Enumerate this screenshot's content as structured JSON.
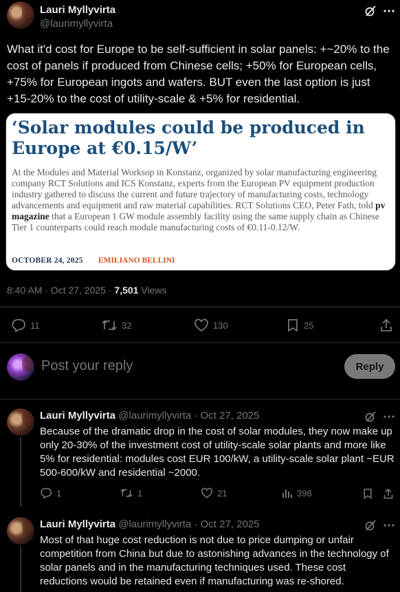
{
  "main_tweet": {
    "author_name": "Lauri Myllyvirta",
    "author_handle": "@laurimyllyvirta",
    "text": "What it'd cost for Europe to be self-sufficient in solar panels: +~20% to the cost of panels if produced from Chinese cells; +50% for European cells, +75% for European ingots and wafers. BUT even the last option is just +15-20% to the cost of utility-scale & +5% for residential.",
    "card": {
      "title": "‘Solar modules could be produced in Europe at €0.15/W’",
      "body_pre": "At the Modules and Material Worksop in Konstanz, organized by solar manufacturing engineering company RCT Solutions and ICS Konstanz, experts from the European PV equipment production industry gathered to discuss the current and future trajectory of manufacturing costs, technology advancements and equipment and raw material capabilities. RCT Solutions CEO, Peter Fath, told ",
      "body_bold": "pv magazine",
      "body_post": " that a European 1 GW module assembly facility using the same supply chain as Chinese Tier 1 counterparts could reach module manufacturing costs of €0.11-0.12/W.",
      "date": "OCTOBER 24, 2025",
      "author": "EMILIANO BELLINI"
    },
    "time": "8:40 AM · Oct 27, 2025 · ",
    "views_count": "7,501",
    "views_label": " Views",
    "actions": {
      "replies": "11",
      "reposts": "32",
      "likes": "130",
      "bookmarks": "25"
    }
  },
  "reply_box": {
    "placeholder": "Post your reply",
    "button_label": "Reply"
  },
  "replies": [
    {
      "author_name": "Lauri Myllyvirta",
      "meta": "@laurimyllyvirta · Oct 27, 2025",
      "text": "Because of the dramatic drop in the cost of solar modules, they now make up only 20-30% of the investment cost of utility-scale solar plants and more like 5% for residential: modules cost EUR 100/kW, a utility-scale solar plant ~EUR 500-600/kW and residential ~2000.",
      "replies": "1",
      "reposts": "1",
      "likes": "21",
      "views": "398"
    },
    {
      "author_name": "Lauri Myllyvirta",
      "meta": "@laurimyllyvirta · Oct 27, 2025",
      "text": "Most of that huge cost reduction is not due to price dumping or unfair competition from China but due to astonishing advances in the technology of solar panels and in the manufacturing techniques used. These cost reductions would be retained even if manufacturing was re-shored."
    }
  ],
  "colors": {
    "background": "#000000",
    "text": "#e7e9ea",
    "muted": "#71767b",
    "divider": "#2f3336",
    "card_title": "#1c4f7c",
    "card_author": "#d9531e"
  }
}
